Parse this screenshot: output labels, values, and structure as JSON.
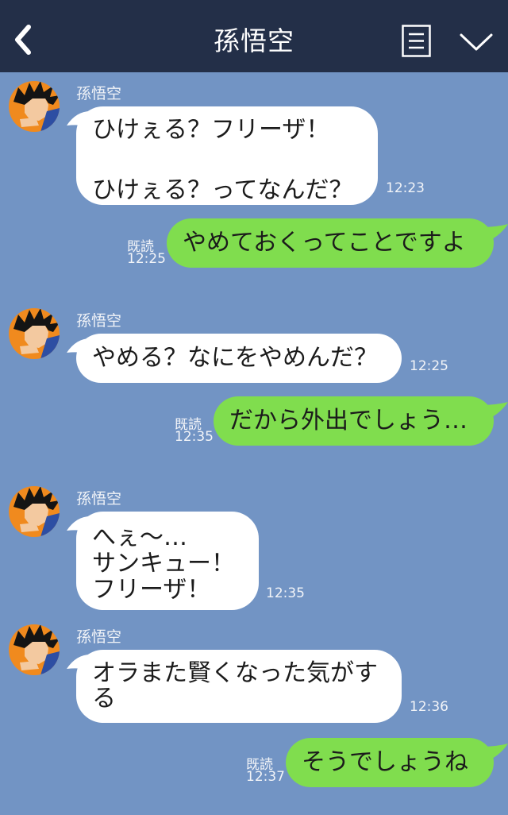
{
  "header": {
    "title": "孫悟空"
  },
  "colors": {
    "header_bg": "#232f48",
    "chat_bg": "#7294c4",
    "incoming_bubble": "#ffffff",
    "outgoing_bubble": "#80dd4e"
  },
  "messages": [
    {
      "sender": "孫悟空",
      "text": "ひけぇる？フリーザ！\n\nひけぇる？ってなんだ？",
      "time": "12:23"
    },
    {
      "text": "やめておくってことですよ",
      "read": "既読",
      "time": "12:25"
    },
    {
      "sender": "孫悟空",
      "text": "やめる？なにをやめんだ？",
      "time": "12:25"
    },
    {
      "text": "だから外出でしょう…",
      "read": "既読",
      "time": "12:35"
    },
    {
      "sender": "孫悟空",
      "text": "へぇ〜…\nサンキュー！\nフリーザ！",
      "time": "12:35"
    },
    {
      "sender": "孫悟空",
      "text": "オラまた賢くなった気がす\nる",
      "time": "12:36"
    },
    {
      "text": "そうでしょうね",
      "read": "既読",
      "time": "12:37"
    }
  ]
}
